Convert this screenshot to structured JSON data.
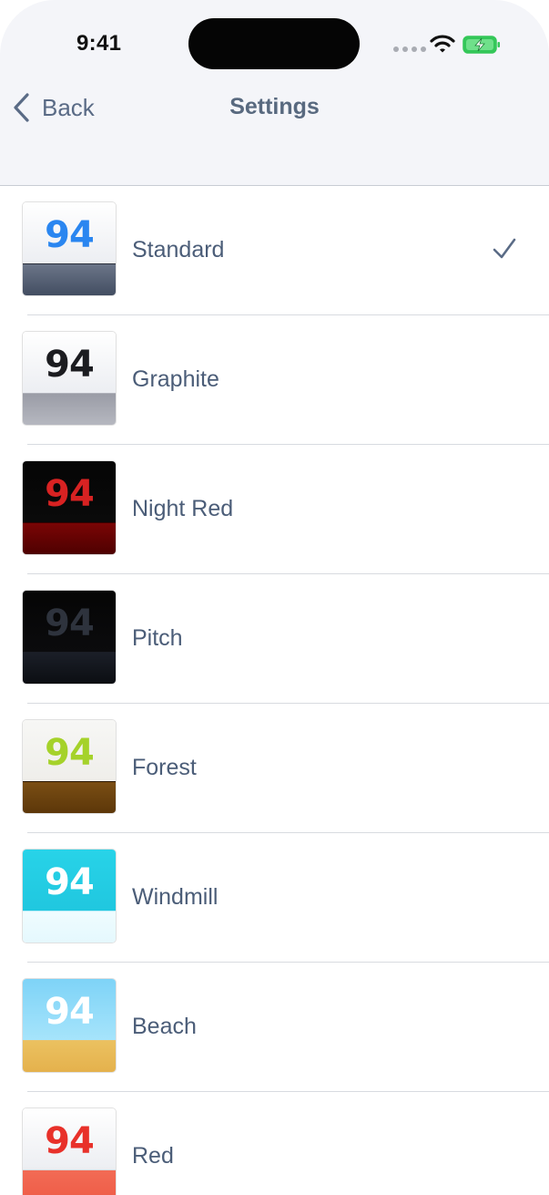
{
  "status_bar": {
    "time": "9:41"
  },
  "nav": {
    "back_label": "Back",
    "title": "Settings"
  },
  "themes": [
    {
      "name": "Standard",
      "number": "94",
      "selected": true,
      "top": "linear-gradient(#ffffff,#eceef2)",
      "bottom": "linear-gradient(#6b7588,#3f4a5e)",
      "numColor": "#2a86f0",
      "line": "#2a2f3a"
    },
    {
      "name": "Graphite",
      "number": "94",
      "selected": false,
      "top": "linear-gradient(#ffffff,#eceef2)",
      "bottom": "linear-gradient(#9a9ca6,#b8bac2)",
      "numColor": "#1b1c20",
      "line": "#b0b2ba"
    },
    {
      "name": "Night Red",
      "number": "94",
      "selected": false,
      "top": "linear-gradient(#050505,#0a0a0a)",
      "bottom": "linear-gradient(#7a0505,#4a0000)",
      "numColor": "#d82222",
      "line": "#3a0000"
    },
    {
      "name": "Pitch",
      "number": "94",
      "selected": false,
      "top": "linear-gradient(#050505,#0b0b0d)",
      "bottom": "linear-gradient(#1b1f28,#0a0c10)",
      "numColor": "#2e333d",
      "line": "#1a1d24"
    },
    {
      "name": "Forest",
      "number": "94",
      "selected": false,
      "top": "linear-gradient(#f7f7f5,#efeeea)",
      "bottom": "linear-gradient(#7a4e14,#5a3508)",
      "numColor": "#a5d22a",
      "line": "#2a1500"
    },
    {
      "name": "Windmill",
      "number": "94",
      "selected": false,
      "top": "linear-gradient(#28d3e8,#20c7df)",
      "bottom": "linear-gradient(#effcff,#e4f8fd)",
      "numColor": "#ffffff",
      "line": "#bdeef8"
    },
    {
      "name": "Beach",
      "number": "94",
      "selected": false,
      "top": "linear-gradient(#7ed3f7,#a6e4fb)",
      "bottom": "linear-gradient(#ebc160,#e4b04b)",
      "numColor": "#ffffff",
      "line": "#e9c26a"
    },
    {
      "name": "Red",
      "number": "94",
      "selected": false,
      "top": "linear-gradient(#ffffff,#eceef2)",
      "bottom": "linear-gradient(#f26b55,#ee5a45)",
      "numColor": "#e8312a",
      "line": "#d6d8dc"
    }
  ]
}
